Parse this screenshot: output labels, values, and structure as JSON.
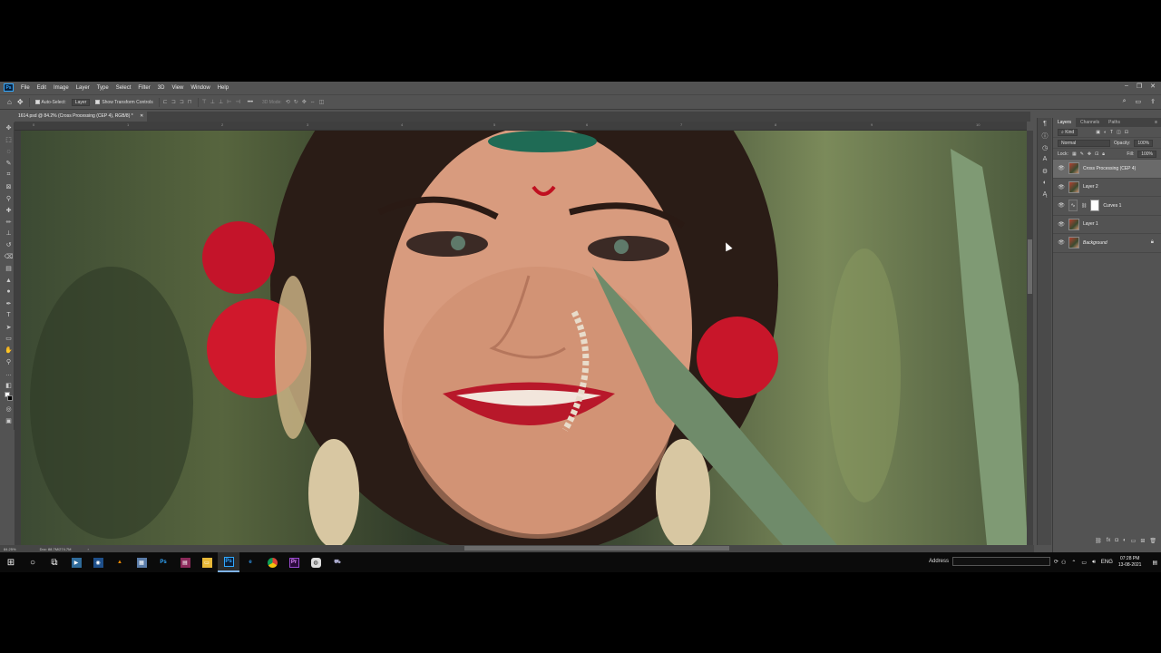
{
  "app": {
    "logo_text": "Ps",
    "menu": [
      "File",
      "Edit",
      "Image",
      "Layer",
      "Type",
      "Select",
      "Filter",
      "3D",
      "View",
      "Window",
      "Help"
    ],
    "window_controls": [
      "–",
      "❐",
      "✕"
    ]
  },
  "options_bar": {
    "auto_select_label": "Auto-Select:",
    "auto_select_target": "Layer",
    "show_transform_label": "Show Transform Controls",
    "mode_3d_label": "3D Mode:"
  },
  "document": {
    "tab_title": "1614.psd @ 84.2% (Cross Processing (CEP 4), RGB/8) *",
    "ruler_ticks": [
      "0",
      "1",
      "2",
      "3",
      "4",
      "5",
      "6",
      "7",
      "8",
      "9",
      "10"
    ]
  },
  "status_bar": {
    "zoom": "84.25%",
    "doc_info": "Doc: 88.7M/274.7M"
  },
  "layers_panel": {
    "tabs": [
      "Layers",
      "Channels",
      "Paths"
    ],
    "active_tab": "Layers",
    "filter_kind": "Kind",
    "blend_mode": "Normal",
    "opacity_label": "Opacity:",
    "opacity_value": "100%",
    "lock_label": "Lock:",
    "fill_label": "Fill:",
    "fill_value": "100%",
    "layers": [
      {
        "name": "Cross Processing (CEP 4)",
        "selected": true,
        "type": "image"
      },
      {
        "name": "Layer 2",
        "selected": false,
        "type": "image"
      },
      {
        "name": "Curves 1",
        "selected": false,
        "type": "adjustment"
      },
      {
        "name": "Layer 1",
        "selected": false,
        "type": "image"
      },
      {
        "name": "Background",
        "selected": false,
        "type": "background",
        "locked": true
      }
    ]
  },
  "taskbar": {
    "address_label": "Address",
    "address_value": "",
    "language": "ENG",
    "time": "07:28 PM",
    "date": "13-08-2021"
  },
  "colors": {
    "ps_bg": "#535353",
    "ps_accent": "#31a8ff",
    "taskbar_bg": "#0b0b0b"
  }
}
